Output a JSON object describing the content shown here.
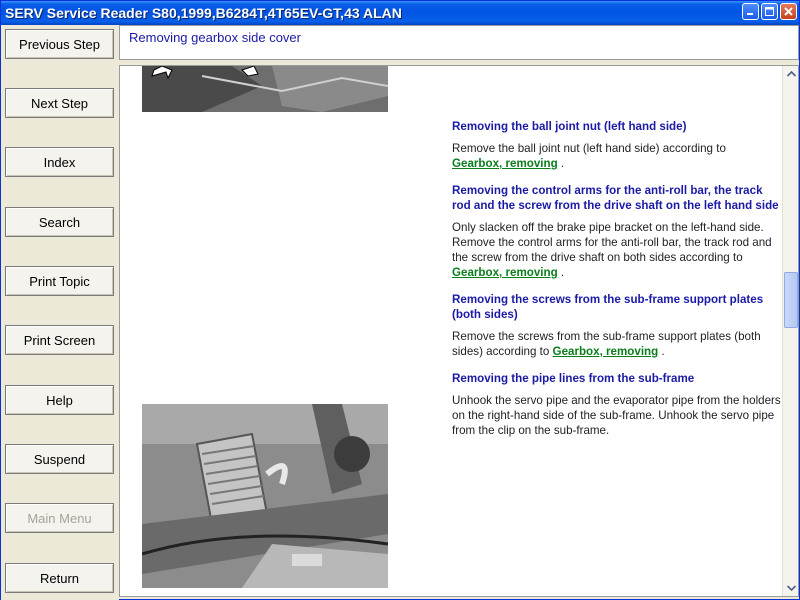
{
  "window": {
    "title": "SERV Service Reader S80,1999,B6284T,4T65EV-GT,43 ALAN"
  },
  "sidebar": {
    "buttons": [
      {
        "label": "Previous Step",
        "enabled": true
      },
      {
        "label": "Next Step",
        "enabled": true
      },
      {
        "label": "Index",
        "enabled": true
      },
      {
        "label": "Search",
        "enabled": true
      },
      {
        "label": "Print Topic",
        "enabled": true
      },
      {
        "label": "Print Screen",
        "enabled": true
      },
      {
        "label": "Help",
        "enabled": true
      },
      {
        "label": "Suspend",
        "enabled": true
      },
      {
        "label": "Main Menu",
        "enabled": false
      },
      {
        "label": "Return",
        "enabled": true
      }
    ]
  },
  "header": {
    "title": "Removing gearbox side cover"
  },
  "content": {
    "sections": [
      {
        "heading": "Removing the ball joint nut (left hand side)",
        "body": "Remove the ball joint nut (left hand side) according to",
        "link": "Gearbox, removing",
        "after": "."
      },
      {
        "heading": "Removing the control arms for the anti-roll bar, the track rod and the screw from the drive shaft on the left hand side",
        "body": "Only slacken off the brake pipe bracket on the left-hand side. Remove the control arms for the anti-roll bar, the track rod and the screw from the drive shaft on both sides according to",
        "link": "Gearbox, removing",
        "after": "."
      },
      {
        "heading": "Removing the screws from the sub-frame support plates (both sides)",
        "body": "Remove the screws from the sub-frame support plates (both sides) according to",
        "link": "Gearbox, removing",
        "after": "."
      },
      {
        "heading": "Removing the pipe lines from the sub-frame",
        "body": "Unhook the servo pipe and the evaporator pipe from the holders on the right-hand side of the sub-frame. Unhook the servo pipe from the clip on the sub-frame.",
        "link": "",
        "after": ""
      }
    ]
  },
  "icons": {
    "minimize": "minimize-icon",
    "maximize": "maximize-icon",
    "close": "close-icon",
    "scroll_up": "chevron-up-icon",
    "scroll_down": "chevron-down-icon"
  },
  "colors": {
    "titlebar": "#0054e3",
    "heading": "#1a1aa6",
    "link": "#0b7d1c",
    "disabled": "#a7a59a"
  }
}
